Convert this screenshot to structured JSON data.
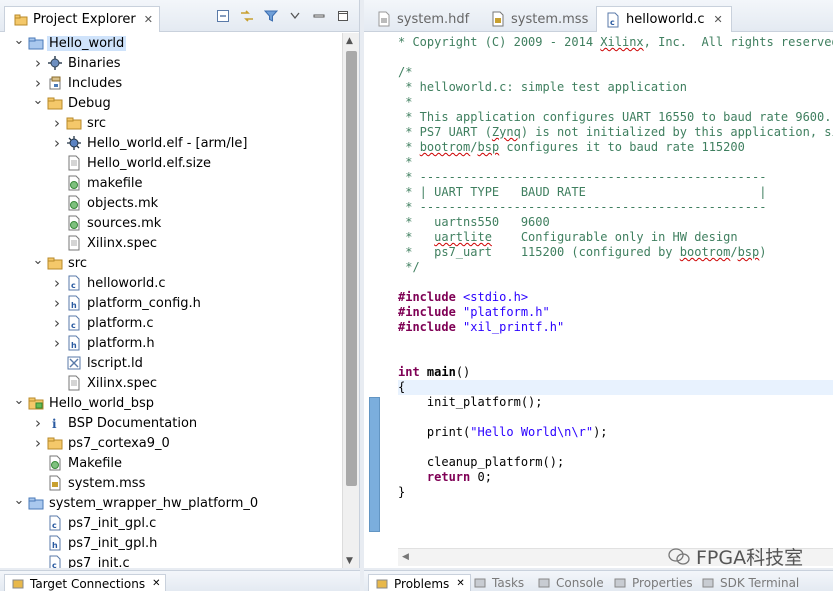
{
  "explorer": {
    "tab_title": "Project Explorer",
    "close": "✕",
    "tree": [
      {
        "label": "Hello_world",
        "depth": 0,
        "twisty": "open",
        "icon": "folder-project-icon",
        "selected": true
      },
      {
        "label": "Binaries",
        "depth": 1,
        "twisty": "closed",
        "icon": "binaries-icon"
      },
      {
        "label": "Includes",
        "depth": 1,
        "twisty": "closed",
        "icon": "includes-icon"
      },
      {
        "label": "Debug",
        "depth": 1,
        "twisty": "open",
        "icon": "folder-icon"
      },
      {
        "label": "src",
        "depth": 2,
        "twisty": "closed",
        "icon": "folder-icon"
      },
      {
        "label": "Hello_world.elf - [arm/le]",
        "depth": 2,
        "twisty": "closed",
        "icon": "elf-icon"
      },
      {
        "label": "Hello_world.elf.size",
        "depth": 2,
        "twisty": "none",
        "icon": "file-icon"
      },
      {
        "label": "makefile",
        "depth": 2,
        "twisty": "none",
        "icon": "makefile-icon"
      },
      {
        "label": "objects.mk",
        "depth": 2,
        "twisty": "none",
        "icon": "makefile-icon"
      },
      {
        "label": "sources.mk",
        "depth": 2,
        "twisty": "none",
        "icon": "makefile-icon"
      },
      {
        "label": "Xilinx.spec",
        "depth": 2,
        "twisty": "none",
        "icon": "file-icon"
      },
      {
        "label": "src",
        "depth": 1,
        "twisty": "open",
        "icon": "folder-icon"
      },
      {
        "label": "helloworld.c",
        "depth": 2,
        "twisty": "closed",
        "icon": "c-file-icon"
      },
      {
        "label": "platform_config.h",
        "depth": 2,
        "twisty": "closed",
        "icon": "h-file-icon"
      },
      {
        "label": "platform.c",
        "depth": 2,
        "twisty": "closed",
        "icon": "c-file-icon"
      },
      {
        "label": "platform.h",
        "depth": 2,
        "twisty": "closed",
        "icon": "h-file-icon"
      },
      {
        "label": "lscript.ld",
        "depth": 2,
        "twisty": "none",
        "icon": "linker-script-icon"
      },
      {
        "label": "Xilinx.spec",
        "depth": 2,
        "twisty": "none",
        "icon": "file-icon"
      },
      {
        "label": "Hello_world_bsp",
        "depth": 0,
        "twisty": "open",
        "icon": "bsp-project-icon"
      },
      {
        "label": "BSP Documentation",
        "depth": 1,
        "twisty": "closed",
        "icon": "info-icon"
      },
      {
        "label": "ps7_cortexa9_0",
        "depth": 1,
        "twisty": "closed",
        "icon": "folder-icon"
      },
      {
        "label": "Makefile",
        "depth": 1,
        "twisty": "none",
        "icon": "makefile-icon"
      },
      {
        "label": "system.mss",
        "depth": 1,
        "twisty": "none",
        "icon": "mss-file-icon"
      },
      {
        "label": "system_wrapper_hw_platform_0",
        "depth": 0,
        "twisty": "open",
        "icon": "folder-project-icon"
      },
      {
        "label": "ps7_init_gpl.c",
        "depth": 1,
        "twisty": "none",
        "icon": "c-file-icon"
      },
      {
        "label": "ps7_init_gpl.h",
        "depth": 1,
        "twisty": "none",
        "icon": "h-file-icon"
      },
      {
        "label": "ps7_init.c",
        "depth": 1,
        "twisty": "none",
        "icon": "c-file-icon"
      }
    ]
  },
  "editor": {
    "tabs": [
      {
        "label": "system.hdf",
        "icon": "hdf-file-icon",
        "active": false
      },
      {
        "label": "system.mss",
        "icon": "mss-file-icon",
        "active": false
      },
      {
        "label": "helloworld.c",
        "icon": "c-file-icon",
        "active": true
      }
    ],
    "code": [
      {
        "fold": "+",
        "parts": [
          [
            "c-comment",
            "* Copyright (C) 2009 - 2014 "
          ],
          [
            "c-comment squiggle",
            "Xilinx"
          ],
          [
            "c-comment",
            ", Inc.  All rights reserved."
          ]
        ]
      },
      {
        "parts": []
      },
      {
        "fold": "-",
        "parts": [
          [
            "c-comment",
            "/*"
          ]
        ]
      },
      {
        "parts": [
          [
            "c-comment",
            " * helloworld.c: simple test application"
          ]
        ]
      },
      {
        "parts": [
          [
            "c-comment",
            " *"
          ]
        ]
      },
      {
        "parts": [
          [
            "c-comment",
            " * This application configures UART 16550 to baud rate 9600."
          ]
        ]
      },
      {
        "parts": [
          [
            "c-comment",
            " * PS7 UART ("
          ],
          [
            "c-comment squiggle",
            "Zynq"
          ],
          [
            "c-comment",
            ") is not initialized by this application, since"
          ]
        ]
      },
      {
        "parts": [
          [
            "c-comment",
            " * "
          ],
          [
            "c-comment squiggle",
            "bootrom"
          ],
          [
            "c-comment",
            "/"
          ],
          [
            "c-comment squiggle",
            "bsp"
          ],
          [
            "c-comment",
            " configures it to baud rate 115200"
          ]
        ]
      },
      {
        "parts": [
          [
            "c-comment",
            " *"
          ]
        ]
      },
      {
        "parts": [
          [
            "c-comment",
            " * ------------------------------------------------"
          ]
        ]
      },
      {
        "parts": [
          [
            "c-comment",
            " * | UART TYPE   BAUD RATE                        |"
          ]
        ]
      },
      {
        "parts": [
          [
            "c-comment",
            " * ------------------------------------------------"
          ]
        ]
      },
      {
        "parts": [
          [
            "c-comment",
            " *   uartns550   9600"
          ]
        ]
      },
      {
        "parts": [
          [
            "c-comment",
            " *   "
          ],
          [
            "c-comment squiggle",
            "uartlite"
          ],
          [
            "c-comment",
            "    Configurable only in HW design"
          ]
        ]
      },
      {
        "parts": [
          [
            "c-comment",
            " *   ps7_uart    115200 (configured by "
          ],
          [
            "c-comment squiggle",
            "bootrom"
          ],
          [
            "c-comment",
            "/"
          ],
          [
            "c-comment squiggle",
            "bsp"
          ],
          [
            "c-comment",
            ")"
          ]
        ]
      },
      {
        "parts": [
          [
            "c-comment",
            " */"
          ]
        ]
      },
      {
        "parts": []
      },
      {
        "parts": [
          [
            "c-directive",
            "#include"
          ],
          [
            "c-plain",
            " "
          ],
          [
            "c-string",
            "<stdio.h>"
          ]
        ]
      },
      {
        "parts": [
          [
            "c-directive",
            "#include"
          ],
          [
            "c-plain",
            " "
          ],
          [
            "c-string",
            "\"platform.h\""
          ]
        ]
      },
      {
        "parts": [
          [
            "c-directive",
            "#include"
          ],
          [
            "c-plain",
            " "
          ],
          [
            "c-string",
            "\"xil_printf.h\""
          ]
        ]
      },
      {
        "parts": []
      },
      {
        "parts": []
      },
      {
        "fold": "-",
        "parts": [
          [
            "c-keyword",
            "int"
          ],
          [
            "c-plain",
            " "
          ],
          [
            "c-plain c-bold",
            "main"
          ],
          [
            "c-plain",
            "()"
          ]
        ]
      },
      {
        "current": true,
        "parts": [
          [
            "c-plain",
            "{"
          ]
        ]
      },
      {
        "parts": [
          [
            "c-plain",
            "    init_platform();"
          ]
        ]
      },
      {
        "parts": []
      },
      {
        "parts": [
          [
            "c-plain",
            "    print("
          ],
          [
            "c-string",
            "\"Hello World\\n\\r\""
          ],
          [
            "c-plain",
            ");"
          ]
        ]
      },
      {
        "parts": []
      },
      {
        "parts": [
          [
            "c-plain",
            "    cleanup_platform();"
          ]
        ]
      },
      {
        "parts": [
          [
            "c-plain",
            "    "
          ],
          [
            "c-keyword",
            "return"
          ],
          [
            "c-plain",
            " 0;"
          ]
        ]
      },
      {
        "parts": [
          [
            "c-plain",
            "}"
          ]
        ]
      }
    ]
  },
  "bottom_left": {
    "tabs": [
      {
        "label": "Target Connections",
        "active": true
      }
    ]
  },
  "bottom_right": {
    "tabs": [
      {
        "label": "Problems",
        "active": true
      },
      {
        "label": "Tasks",
        "active": false
      },
      {
        "label": "Console",
        "active": false
      },
      {
        "label": "Properties",
        "active": false
      },
      {
        "label": "SDK Terminal",
        "active": false
      }
    ]
  },
  "watermark": {
    "text": "FPGA科技室"
  },
  "colors": {
    "accent": "#5b9bd5",
    "selection": "#cfe3fb",
    "comment": "#3f7f5f",
    "keyword": "#7f0055",
    "string": "#2a00ff"
  }
}
